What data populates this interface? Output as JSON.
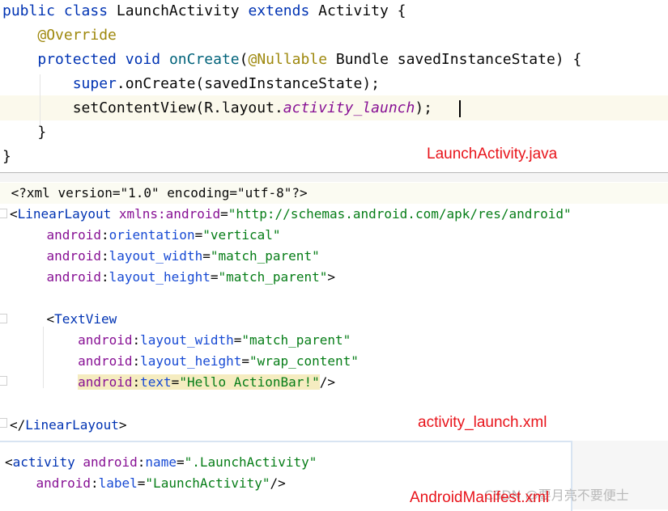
{
  "java": {
    "lines": [
      [
        {
          "t": "public",
          "c": "kw"
        },
        {
          "t": " "
        },
        {
          "t": "class",
          "c": "kw"
        },
        {
          "t": " LaunchActivity "
        },
        {
          "t": "extends",
          "c": "kw"
        },
        {
          "t": " Activity {"
        }
      ],
      [
        {
          "t": "    "
        },
        {
          "t": "@Override",
          "c": "ann"
        }
      ],
      [
        {
          "t": "    "
        },
        {
          "t": "protected",
          "c": "kw"
        },
        {
          "t": " "
        },
        {
          "t": "void",
          "c": "kw"
        },
        {
          "t": " "
        },
        {
          "t": "onCreate",
          "c": "fn"
        },
        {
          "t": "("
        },
        {
          "t": "@Nullable",
          "c": "ann"
        },
        {
          "t": " Bundle savedInstanceState) {"
        }
      ],
      [
        {
          "t": "        "
        },
        {
          "t": "super",
          "c": "kw"
        },
        {
          "t": ".onCreate(savedInstanceState);"
        }
      ],
      [
        {
          "t": "        setContentView(R.layout."
        },
        {
          "t": "activity_launch",
          "c": "field"
        },
        {
          "t": ");"
        }
      ],
      [
        {
          "t": "    }"
        }
      ],
      [
        {
          "t": "}"
        }
      ]
    ],
    "caption": "LaunchActivity.java"
  },
  "xml": {
    "lines": [
      [
        {
          "t": " "
        },
        {
          "t": "<?xml version=\"1.0\" encoding=\"utf-8\"?>",
          "c": "plain"
        }
      ],
      [
        {
          "t": "<"
        },
        {
          "t": "LinearLayout",
          "c": "tag"
        },
        {
          "t": " "
        },
        {
          "t": "xmlns:android",
          "c": "ns"
        },
        {
          "t": "="
        },
        {
          "t": "\"http://schemas.android.com/apk/res/android\"",
          "c": "val"
        }
      ],
      [
        {
          "t": "    "
        },
        {
          "t": "android",
          "c": "ns"
        },
        {
          "t": ":"
        },
        {
          "t": "orientation",
          "c": "attr"
        },
        {
          "t": "="
        },
        {
          "t": "\"vertical\"",
          "c": "val"
        }
      ],
      [
        {
          "t": "    "
        },
        {
          "t": "android",
          "c": "ns"
        },
        {
          "t": ":"
        },
        {
          "t": "layout_width",
          "c": "attr"
        },
        {
          "t": "="
        },
        {
          "t": "\"match_parent\"",
          "c": "val"
        }
      ],
      [
        {
          "t": "    "
        },
        {
          "t": "android",
          "c": "ns"
        },
        {
          "t": ":"
        },
        {
          "t": "layout_height",
          "c": "attr"
        },
        {
          "t": "="
        },
        {
          "t": "\"match_parent\"",
          "c": "val"
        },
        {
          "t": ">"
        }
      ],
      [
        {
          "t": ""
        }
      ],
      [
        {
          "t": "    <"
        },
        {
          "t": "TextView",
          "c": "tag"
        }
      ],
      [
        {
          "t": "        "
        },
        {
          "t": "android",
          "c": "ns"
        },
        {
          "t": ":"
        },
        {
          "t": "layout_width",
          "c": "attr"
        },
        {
          "t": "="
        },
        {
          "t": "\"match_parent\"",
          "c": "val"
        }
      ],
      [
        {
          "t": "        "
        },
        {
          "t": "android",
          "c": "ns"
        },
        {
          "t": ":"
        },
        {
          "t": "layout_height",
          "c": "attr"
        },
        {
          "t": "="
        },
        {
          "t": "\"wrap_content\"",
          "c": "val"
        }
      ],
      [
        {
          "t": "        "
        },
        {
          "t": "android",
          "c": "ns",
          "h": true
        },
        {
          "t": ":",
          "h": true
        },
        {
          "t": "text",
          "c": "attr",
          "h": true
        },
        {
          "t": "=",
          "h": true
        },
        {
          "t": "\"Hello ActionBar!\"",
          "c": "val",
          "h": true
        },
        {
          "t": "/>"
        }
      ],
      [
        {
          "t": ""
        }
      ],
      [
        {
          "t": "</"
        },
        {
          "t": "LinearLayout",
          "c": "tag"
        },
        {
          "t": ">"
        }
      ]
    ],
    "caption": "activity_launch.xml"
  },
  "manifest": {
    "lines": [
      [
        {
          "t": "<"
        },
        {
          "t": "activity",
          "c": "tag"
        },
        {
          "t": " "
        },
        {
          "t": "android",
          "c": "ns"
        },
        {
          "t": ":"
        },
        {
          "t": "name",
          "c": "attr"
        },
        {
          "t": "="
        },
        {
          "t": "\".LaunchActivity\"",
          "c": "val"
        }
      ],
      [
        {
          "t": "    "
        },
        {
          "t": "android",
          "c": "ns"
        },
        {
          "t": ":"
        },
        {
          "t": "label",
          "c": "attr"
        },
        {
          "t": "="
        },
        {
          "t": "\"LaunchActivity\"",
          "c": "val"
        },
        {
          "t": "/>"
        }
      ]
    ],
    "caption": "AndroidManifest.xml"
  },
  "watermark": "CSDN @要月亮不要便士"
}
